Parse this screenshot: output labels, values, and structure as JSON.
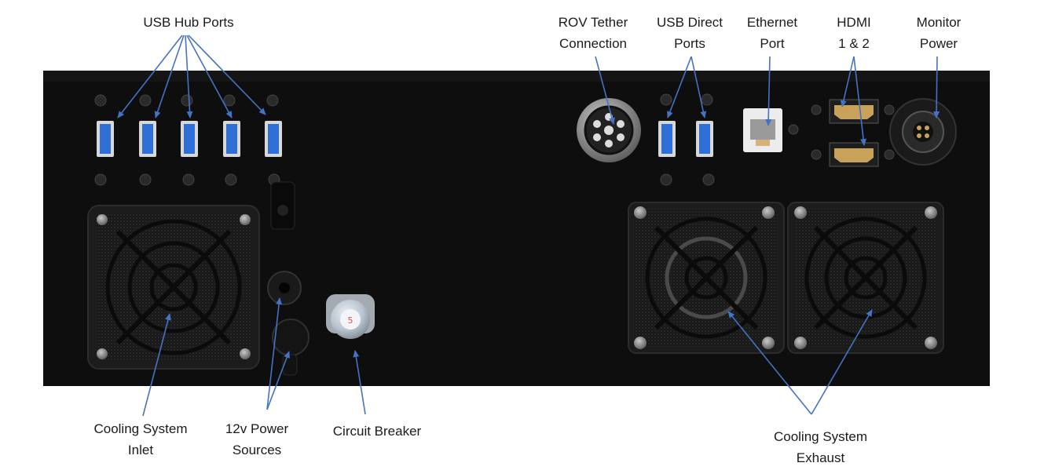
{
  "colors": {
    "panel": "#0e0e0e",
    "arrow": "#4472c4",
    "usb_blue": "#2f6fd6",
    "label_text": "#1a1a1a"
  },
  "labels": {
    "usb_hub_ports": "USB Hub Ports",
    "rov_tether_l1": "ROV Tether",
    "rov_tether_l2": "Connection",
    "usb_direct_l1": "USB Direct",
    "usb_direct_l2": "Ports",
    "ethernet_l1": "Ethernet",
    "ethernet_l2": "Port",
    "hdmi_l1": "HDMI",
    "hdmi_l2": "1 & 2",
    "monitor_l1": "Monitor",
    "monitor_l2": "Power",
    "cooling_inlet_l1": "Cooling System",
    "cooling_inlet_l2": "Inlet",
    "power_l1": "12v Power",
    "power_l2": "Sources",
    "circuit_breaker": "Circuit Breaker",
    "cooling_exhaust_l1": "Cooling System",
    "cooling_exhaust_l2": "Exhaust"
  }
}
